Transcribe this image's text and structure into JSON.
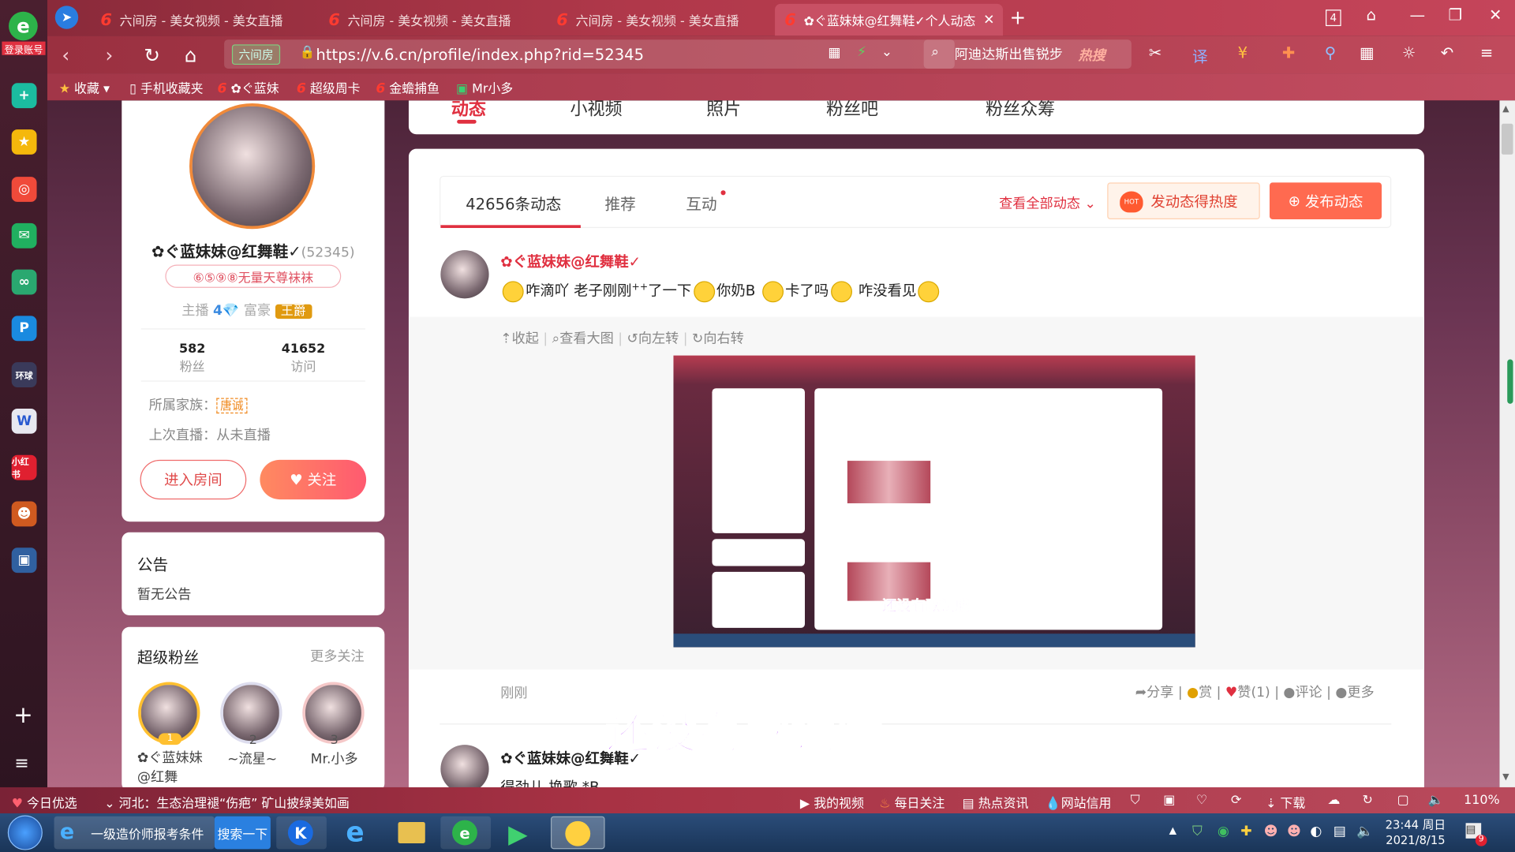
{
  "rail": {
    "login": "登录账号"
  },
  "tabs": [
    {
      "label": "六间房 - 美女视频 - 美女直播"
    },
    {
      "label": "六间房 - 美女视频 - 美女直播"
    },
    {
      "label": "六间房 - 美女视频 - 美女直播"
    },
    {
      "label": "✿ぐ蓝妹妹@红舞鞋✓个人动态"
    }
  ],
  "window": {
    "tab_count": "4"
  },
  "address": {
    "url": "https://v.6.cn/profile/index.php?rid=52345",
    "site_tag": "六间房",
    "search": "阿迪达斯出售锐步",
    "hot": "热搜"
  },
  "bookmarks": [
    "收藏",
    "手机收藏夹",
    "✿ぐ蓝妹",
    "超级周卡",
    "金蟾捕鱼",
    "Mr小多"
  ],
  "profile_nav": [
    "动态",
    "小视频",
    "照片",
    "粉丝吧",
    "粉丝众筹"
  ],
  "profile": {
    "name": "✿ぐ蓝妹妹@红舞鞋✓",
    "rid": "(52345)",
    "title": "⑥⑤⑨⑧无量天尊袜袜",
    "anchor_label": "主播",
    "rich_label": "富豪",
    "rich_badge": "王爵",
    "fans_count": "582",
    "fans_label": "粉丝",
    "visits_count": "41652",
    "visits_label": "访问",
    "family_label": "所属家族：",
    "family_badge": "唐诚",
    "last_live": "上次直播：从未直播",
    "enter_room": "进入房间",
    "follow": "关注"
  },
  "notice": {
    "title": "公告",
    "text": "暂无公告"
  },
  "superfans": {
    "title": "超级粉丝",
    "more": "更多关注",
    "list": [
      {
        "rank": "1",
        "name": "✿ぐ蓝妹妹@红舞"
      },
      {
        "rank": "2",
        "name": "~流星~"
      },
      {
        "rank": "3",
        "name": "Mr.小多"
      }
    ]
  },
  "feed": {
    "tabs": [
      "42656条动态",
      "推荐",
      "互动"
    ],
    "view_all": "查看全部动态",
    "hot_btn": "发动态得热度",
    "hot_tag": "HOT",
    "post_btn": "发布动态",
    "post1": {
      "author": "✿ぐ蓝妹妹@红舞鞋✓",
      "t1": "咋滴吖 老子刚刚",
      "t2": "了一下",
      "t3": "你奶B",
      "t4": "卡了吗",
      "t5": " 咋没看见",
      "tools": [
        "收起",
        "查看大图",
        "向左转",
        "向右转"
      ],
      "thumb_caption": "还没有歌词哦",
      "time": "刚刚",
      "actions": [
        "分享",
        "赏",
        "赞(1)",
        "评论",
        "更多"
      ]
    },
    "post2": {
      "author": "✿ぐ蓝妹妹@红舞鞋✓",
      "text": "得劲儿 换歌 *B"
    },
    "lyric": "还没有歌词哦"
  },
  "statusbar": {
    "left1": "今日优选",
    "left2": "河北：生态治理褪“伤疤” 矿山披绿美如画",
    "items": [
      "我的视频",
      "每日关注",
      "热点资讯",
      "网站信用",
      "下载"
    ],
    "zoom": "110%"
  },
  "taskbar": {
    "ie_item": "一级造价师报考条件",
    "search_btn": "搜索一下",
    "time": "23:44 周日",
    "date": "2021/8/15",
    "badge": "9"
  },
  "colors": {
    "accent": "#ff5a70",
    "brand": "#e0303c"
  }
}
